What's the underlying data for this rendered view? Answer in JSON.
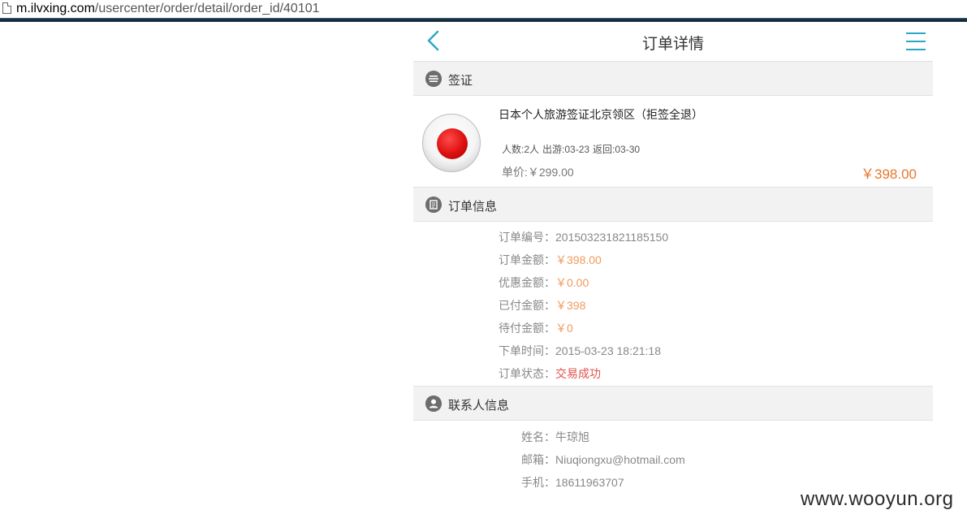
{
  "browser": {
    "url_host": "m.ilvxing.com",
    "url_path": "/usercenter/order/detail/order_id/40101"
  },
  "header": {
    "title": "订单详情"
  },
  "visa_section": {
    "title": "签证",
    "product": {
      "name": "日本个人旅游签证北京领区（拒签全退）",
      "people": "人数:2人",
      "depart": "出游:03-23",
      "return": "返回:03-30",
      "unit_price": "单价:￥299.00",
      "total": "￥398.00"
    }
  },
  "order_section": {
    "title": "订单信息",
    "rows": [
      {
        "key": "订单编号：",
        "value": "201503231821185150"
      },
      {
        "key": "订单金额：",
        "value": "￥398.00"
      },
      {
        "key": "优惠金额：",
        "value": "￥0.00"
      },
      {
        "key": "已付金额：",
        "value": "￥398"
      },
      {
        "key": "待付金额：",
        "value": "￥0"
      },
      {
        "key": "下单时间：",
        "value": "2015-03-23 18:21:18"
      },
      {
        "key": "订单状态：",
        "value": "交易成功"
      }
    ]
  },
  "contact_section": {
    "title": "联系人信息",
    "rows": [
      {
        "key": "姓名：",
        "value": "牛琼旭"
      },
      {
        "key": "邮箱：",
        "value": "Niuqiongxu@hotmail.com"
      },
      {
        "key": "手机：",
        "value": "18611963707"
      }
    ]
  },
  "watermark": "www.wooyun.org",
  "colors": {
    "accent": "#2aa7c4",
    "price": "#e8782c",
    "status": "#e0544c"
  }
}
